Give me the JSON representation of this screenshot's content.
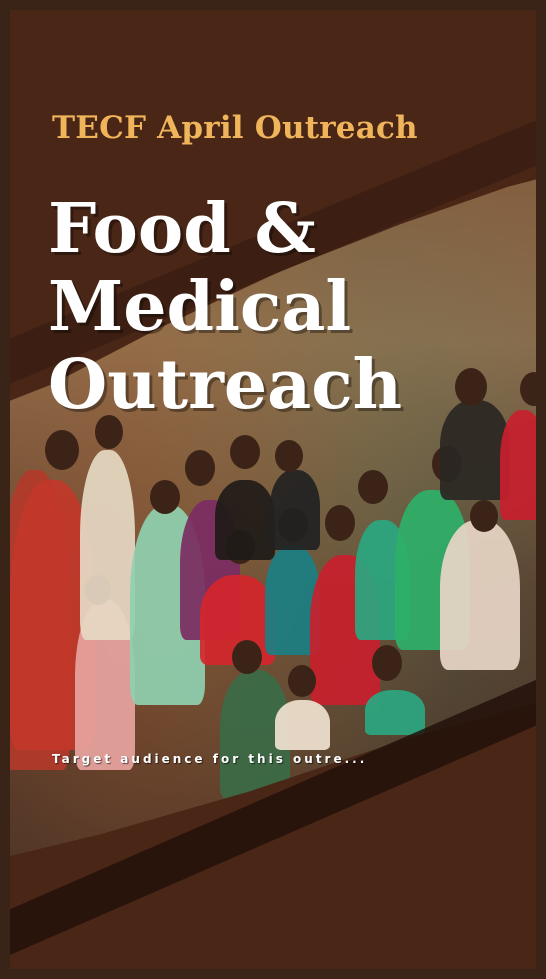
{
  "poster": {
    "subtitle": "TECF April Outreach",
    "title_lines": [
      "Food &",
      "Medical",
      "Outreach"
    ],
    "caption": "Target audience for this outre...",
    "colors": {
      "background": "#4a2617",
      "subtitle": "#f0b55b",
      "title": "#ffffff"
    },
    "photo_description_icon": "crowd-photo"
  }
}
